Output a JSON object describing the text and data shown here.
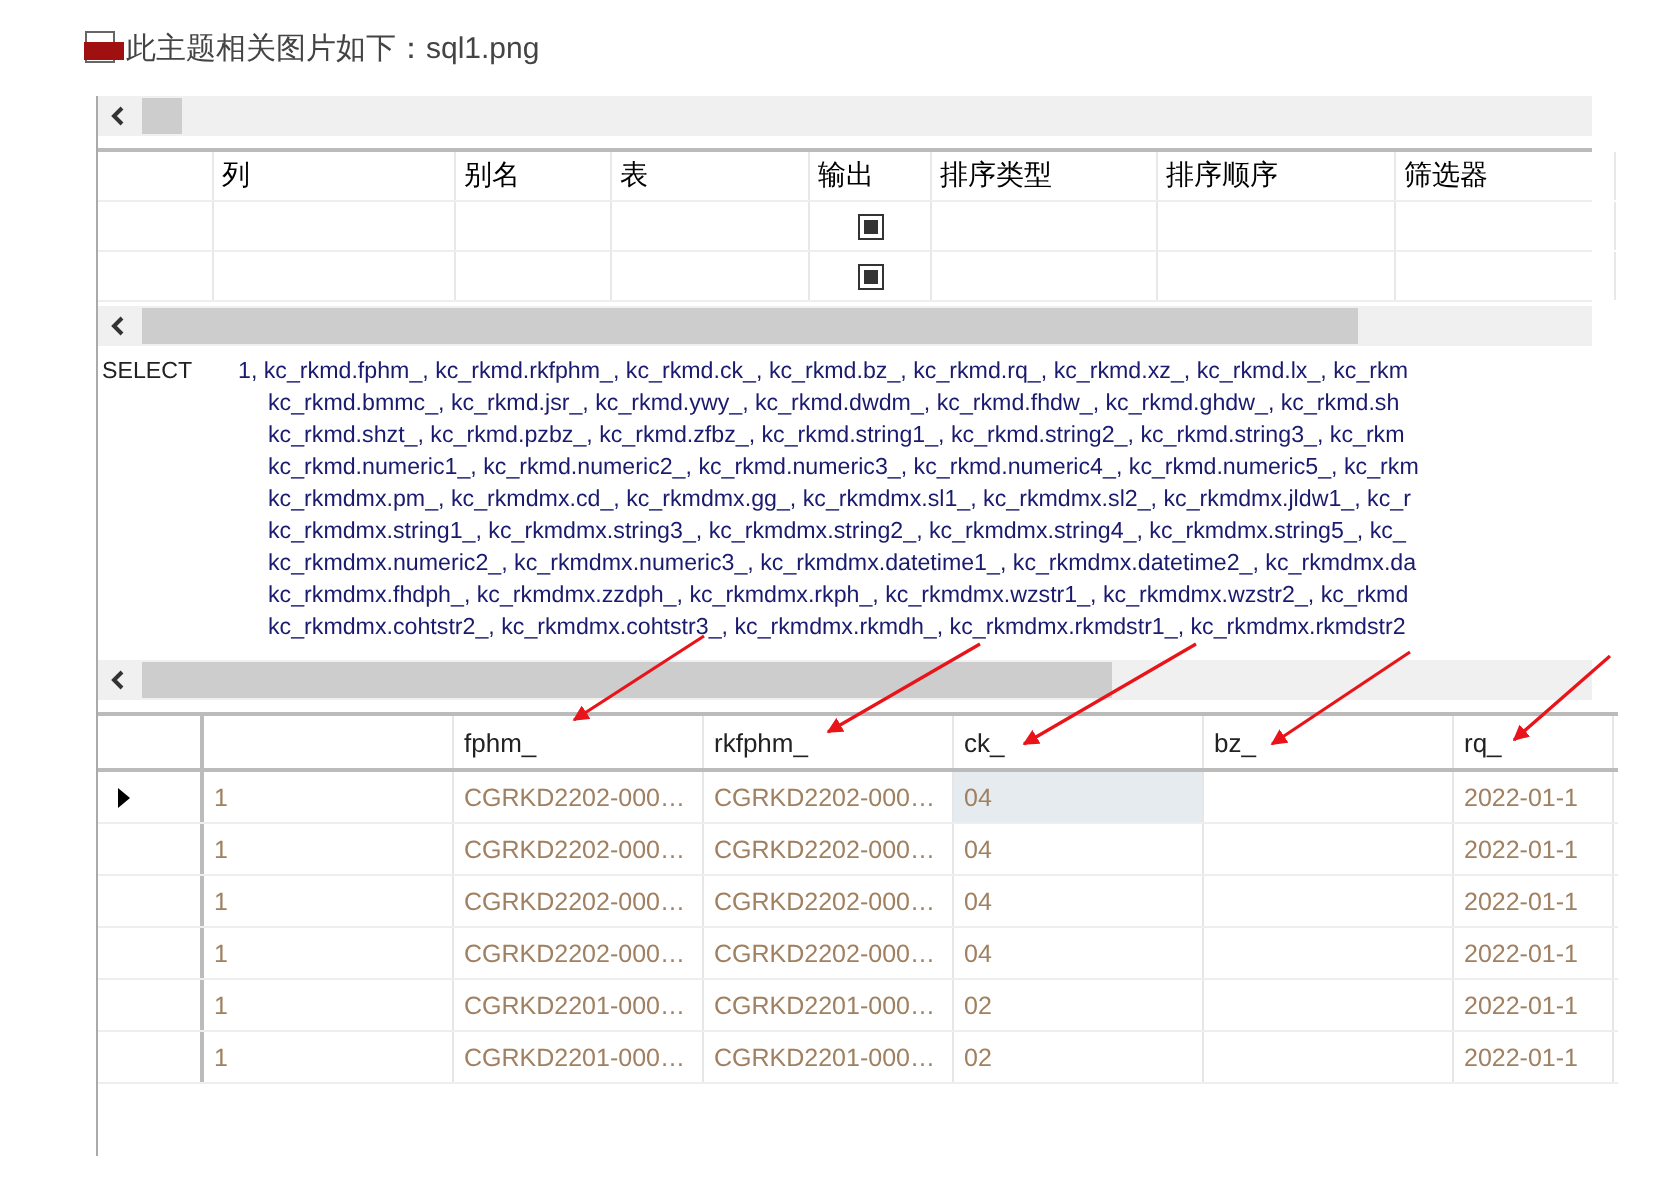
{
  "caption": "此主题相关图片如下：sql1.png",
  "design_grid": {
    "columns": [
      {},
      {
        "label": "列"
      },
      {
        "label": "别名"
      },
      {
        "label": "表"
      },
      {
        "label": "输出"
      },
      {
        "label": "排序类型"
      },
      {
        "label": "排序顺序"
      },
      {
        "label": "筛选器"
      }
    ],
    "rows": [
      {
        "output_checked": true
      },
      {
        "output_checked": true
      }
    ]
  },
  "sql": {
    "keyword": "SELECT",
    "lines": [
      "1, kc_rkmd.fphm_, kc_rkmd.rkfphm_, kc_rkmd.ck_, kc_rkmd.bz_, kc_rkmd.rq_, kc_rkmd.xz_, kc_rkmd.lx_, kc_rkm",
      "kc_rkmd.bmmc_, kc_rkmd.jsr_, kc_rkmd.ywy_, kc_rkmd.dwdm_, kc_rkmd.fhdw_, kc_rkmd.ghdw_, kc_rkmd.sh",
      "kc_rkmd.shzt_, kc_rkmd.pzbz_, kc_rkmd.zfbz_, kc_rkmd.string1_, kc_rkmd.string2_, kc_rkmd.string3_, kc_rkm",
      "kc_rkmd.numeric1_, kc_rkmd.numeric2_, kc_rkmd.numeric3_, kc_rkmd.numeric4_, kc_rkmd.numeric5_, kc_rkm",
      "kc_rkmdmx.pm_, kc_rkmdmx.cd_, kc_rkmdmx.gg_, kc_rkmdmx.sl1_, kc_rkmdmx.sl2_, kc_rkmdmx.jldw1_, kc_r",
      "kc_rkmdmx.string1_, kc_rkmdmx.string3_, kc_rkmdmx.string2_, kc_rkmdmx.string4_, kc_rkmdmx.string5_, kc_",
      "kc_rkmdmx.numeric2_, kc_rkmdmx.numeric3_, kc_rkmdmx.datetime1_, kc_rkmdmx.datetime2_, kc_rkmdmx.da",
      "kc_rkmdmx.fhdph_, kc_rkmdmx.zzdph_, kc_rkmdmx.rkph_, kc_rkmdmx.wzstr1_, kc_rkmdmx.wzstr2_, kc_rkmd",
      "kc_rkmdmx.cohtstr2_, kc_rkmdmx.cohtstr3_, kc_rkmdmx.rkmdh_, kc_rkmdmx.rkmdstr1_, kc_rkmdmx.rkmdstr2"
    ]
  },
  "results": {
    "columns": [
      {
        "focused": false
      },
      {
        "label": "fphm_",
        "focused": false
      },
      {
        "label": "rkfphm_",
        "focused": false
      },
      {
        "label": "ck_",
        "focused": true
      },
      {
        "label": "bz_",
        "focused": false
      },
      {
        "label": "rq_",
        "focused": false
      }
    ],
    "rows": [
      {
        "selected": true,
        "cells": [
          "1",
          "CGRKD2202-000…",
          "CGRKD2202-000…",
          "04",
          "",
          "2022-01-1"
        ]
      },
      {
        "selected": false,
        "cells": [
          "1",
          "CGRKD2202-000…",
          "CGRKD2202-000…",
          "04",
          "",
          "2022-01-1"
        ]
      },
      {
        "selected": false,
        "cells": [
          "1",
          "CGRKD2202-000…",
          "CGRKD2202-000…",
          "04",
          "",
          "2022-01-1"
        ]
      },
      {
        "selected": false,
        "cells": [
          "1",
          "CGRKD2202-000…",
          "CGRKD2202-000…",
          "04",
          "",
          "2022-01-1"
        ]
      },
      {
        "selected": false,
        "cells": [
          "1",
          "CGRKD2201-000…",
          "CGRKD2201-000…",
          "02",
          "",
          "2022-01-1"
        ]
      },
      {
        "selected": false,
        "cells": [
          "1",
          "CGRKD2201-000…",
          "CGRKD2201-000…",
          "02",
          "",
          "2022-01-1"
        ]
      }
    ]
  }
}
